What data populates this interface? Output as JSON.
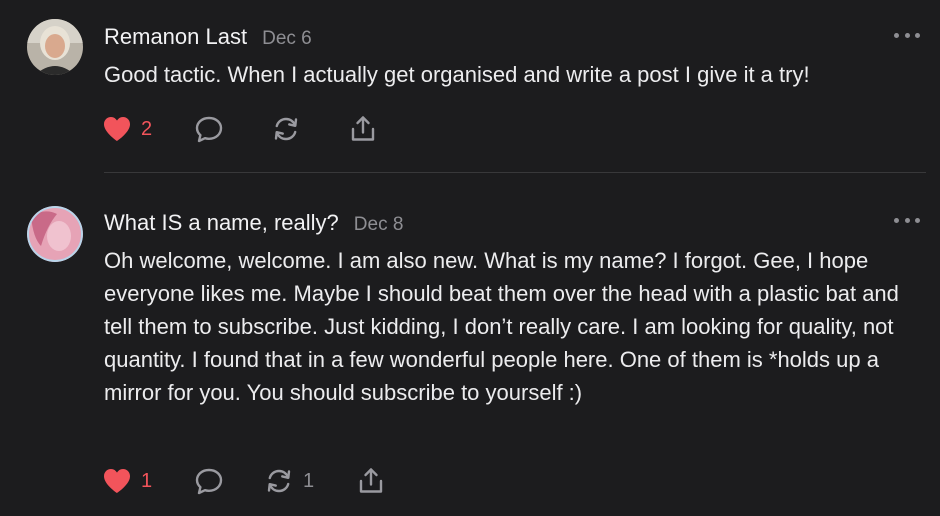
{
  "colors": {
    "background": "#1c1c1e",
    "like_red": "#f2545b",
    "icon_grey": "#8e8e93",
    "text": "#ececee"
  },
  "comments": [
    {
      "author": "Remanon Last",
      "date": "Dec 6",
      "text": "Good tactic. When I actually get organised and write a post I give it a try!",
      "likes": "2",
      "restacks": "",
      "icons": [
        "heart-filled-icon",
        "comment-bubble-icon",
        "restack-icon",
        "share-icon",
        "more-options-icon"
      ]
    },
    {
      "author": "What IS a name, really?",
      "date": "Dec 8",
      "text": "Oh welcome, welcome. I am also new. What is my name? I forgot. Gee, I hope everyone likes me. Maybe I should beat them over the head with a plastic bat and tell them to subscribe. Just kidding, I don’t really care. I am looking for quality, not quantity. I found that in a few wonderful people here. One of them is *holds up a mirror for you. You should subscribe to yourself :)",
      "likes": "1",
      "restacks": "1",
      "icons": [
        "heart-filled-icon",
        "comment-bubble-icon",
        "restack-icon",
        "share-icon",
        "more-options-icon"
      ]
    }
  ]
}
